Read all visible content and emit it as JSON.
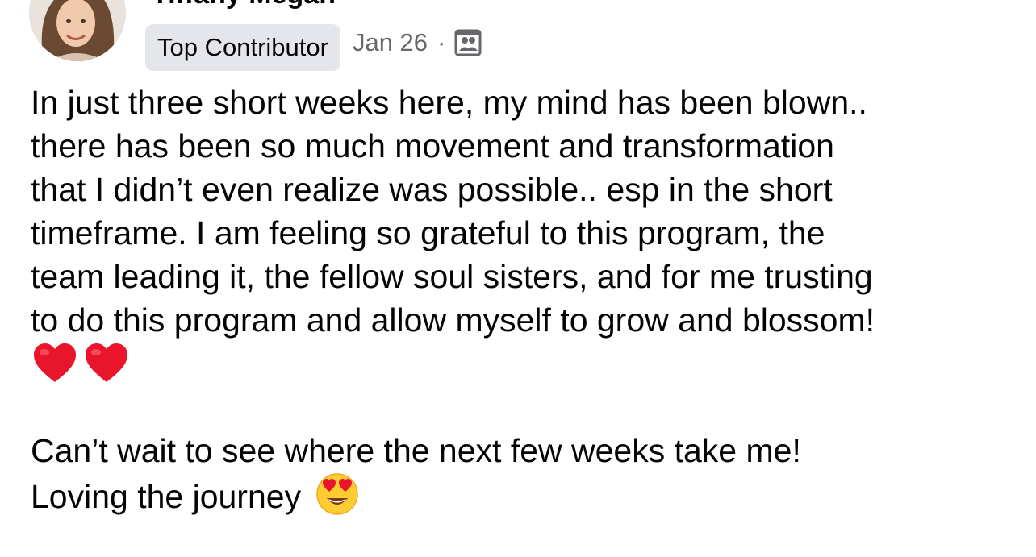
{
  "author": {
    "name": "Tiffany Megan",
    "badge": "Top Contributor",
    "date": "Jan 26",
    "separator": "·",
    "audience_icon": "group-members-icon"
  },
  "post": {
    "lines": [
      "In just three short weeks here, my mind has been blown..",
      "there has been so much movement and transformation",
      "that I didn’t even realize was possible.. esp in the short",
      "timeframe. I am feeling so grateful to this program, the",
      "team leading it, the fellow soul sisters, and for me trusting",
      "to do this program and allow myself to grow and blossom!"
    ],
    "emoji_line": [
      "red-heart-icon",
      "red-heart-icon"
    ],
    "line_after_break": "Can’t wait to see where the next few weeks take me!",
    "last_line": "Loving the journey",
    "last_line_emoji": "heart-eyes-face-icon"
  },
  "colors": {
    "text": "#050505",
    "secondary_text": "#65676b",
    "badge_bg": "#e4e6eb",
    "heart": "#e8152b"
  }
}
